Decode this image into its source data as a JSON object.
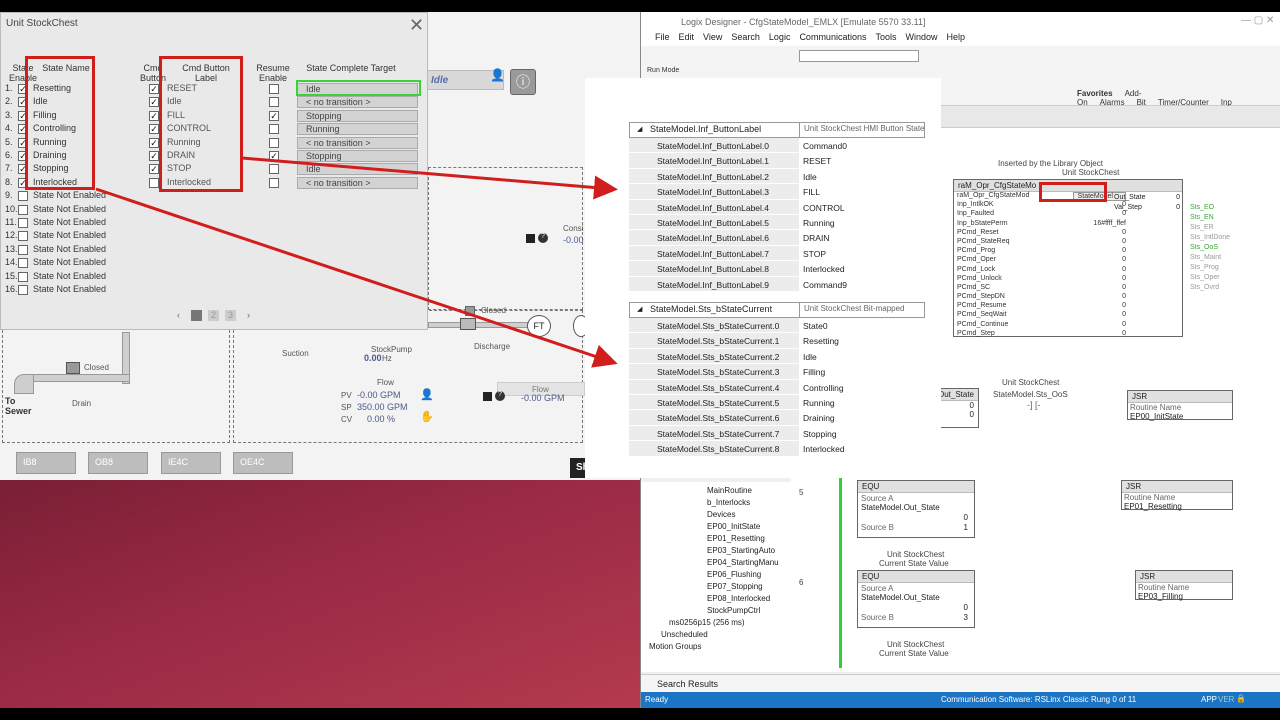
{
  "faceplate": {
    "title": "Unit StockChest",
    "headers": {
      "state_enable": "State Enable",
      "state_name": "State Name",
      "cmd_button": "Cmd Button",
      "cmd_button_label": "Cmd Button Label",
      "resume_enable": "Resume Enable",
      "state_complete_target": "State Complete Target"
    },
    "rows": [
      {
        "n": "1.",
        "enabled": true,
        "name": "Resetting",
        "cmd": true,
        "label": "RESET",
        "resume": false,
        "target": "Idle"
      },
      {
        "n": "2.",
        "enabled": true,
        "name": "Idle",
        "cmd": true,
        "label": "Idle",
        "resume": false,
        "target": "< no transition >"
      },
      {
        "n": "3.",
        "enabled": true,
        "name": "Filling",
        "cmd": true,
        "label": "FILL",
        "resume": true,
        "target": "Stopping"
      },
      {
        "n": "4.",
        "enabled": true,
        "name": "Controlling",
        "cmd": true,
        "label": "CONTROL",
        "resume": false,
        "target": "Running"
      },
      {
        "n": "5.",
        "enabled": true,
        "name": "Running",
        "cmd": true,
        "label": "Running",
        "resume": false,
        "target": "< no transition >"
      },
      {
        "n": "6.",
        "enabled": true,
        "name": "Draining",
        "cmd": true,
        "label": "DRAIN",
        "resume": true,
        "target": "Stopping"
      },
      {
        "n": "7.",
        "enabled": true,
        "name": "Stopping",
        "cmd": true,
        "label": "STOP",
        "resume": false,
        "target": "Idle"
      },
      {
        "n": "8.",
        "enabled": true,
        "name": "Interlocked",
        "cmd": false,
        "label": "Interlocked",
        "resume": false,
        "target": "< no transition >"
      },
      {
        "n": "9.",
        "enabled": false,
        "name": "State Not Enabled"
      },
      {
        "n": "10.",
        "enabled": false,
        "name": "State Not Enabled"
      },
      {
        "n": "11.",
        "enabled": false,
        "name": "State Not Enabled"
      },
      {
        "n": "12.",
        "enabled": false,
        "name": "State Not Enabled"
      },
      {
        "n": "13.",
        "enabled": false,
        "name": "State Not Enabled"
      },
      {
        "n": "14.",
        "enabled": false,
        "name": "State Not Enabled"
      },
      {
        "n": "15.",
        "enabled": false,
        "name": "State Not Enabled"
      },
      {
        "n": "16.",
        "enabled": false,
        "name": "State Not Enabled"
      }
    ],
    "pager": {
      "prev": "‹",
      "page1": "1",
      "page2": "2",
      "page3": "3",
      "next": "›"
    }
  },
  "hmi": {
    "status_value": "Idle",
    "cons_label": "Consi",
    "cons_value": "-0.00",
    "closed1": "Closed",
    "closed2": "Closed",
    "stockpump": "StockPump",
    "pump_hz": "0.00",
    "hz": "Hz",
    "suction": "Suction",
    "discharge": "Discharge",
    "drain": "Drain",
    "to_sewer": "To Sewer",
    "flow1": "Flow",
    "pv_label": "PV",
    "pv_value": "-0.00 GPM",
    "sp_label": "SP",
    "sp_value": "350.00 GPM",
    "cv_label": "CV",
    "cv_value": "0.00 %",
    "flow2": "Flow",
    "flow2_value": "-0.00 GPM",
    "ft": "FT",
    "tags": [
      "IB8",
      "OB8",
      "IE4C",
      "OE4C"
    ],
    "sh": "Sh"
  },
  "overlay": {
    "table1": {
      "header": "StateModel.Inf_ButtonLabel",
      "desc": "Unit StockChest HMI Button State",
      "rows": [
        {
          "tag": "StateModel.Inf_ButtonLabel.0",
          "val": "Command0"
        },
        {
          "tag": "StateModel.Inf_ButtonLabel.1",
          "val": "RESET"
        },
        {
          "tag": "StateModel.Inf_ButtonLabel.2",
          "val": "Idle"
        },
        {
          "tag": "StateModel.Inf_ButtonLabel.3",
          "val": "FILL"
        },
        {
          "tag": "StateModel.Inf_ButtonLabel.4",
          "val": "CONTROL"
        },
        {
          "tag": "StateModel.Inf_ButtonLabel.5",
          "val": "Running"
        },
        {
          "tag": "StateModel.Inf_ButtonLabel.6",
          "val": "DRAIN"
        },
        {
          "tag": "StateModel.Inf_ButtonLabel.7",
          "val": "STOP"
        },
        {
          "tag": "StateModel.Inf_ButtonLabel.8",
          "val": "Interlocked"
        },
        {
          "tag": "StateModel.Inf_ButtonLabel.9",
          "val": "Command9"
        }
      ]
    },
    "table2": {
      "header": "StateModel.Sts_bStateCurrent",
      "desc": "Unit StockChest Bit-mapped",
      "rows": [
        {
          "tag": "StateModel.Sts_bStateCurrent.0",
          "val": "State0"
        },
        {
          "tag": "StateModel.Sts_bStateCurrent.1",
          "val": "Resetting"
        },
        {
          "tag": "StateModel.Sts_bStateCurrent.2",
          "val": "Idle"
        },
        {
          "tag": "StateModel.Sts_bStateCurrent.3",
          "val": "Filling"
        },
        {
          "tag": "StateModel.Sts_bStateCurrent.4",
          "val": "Controlling"
        },
        {
          "tag": "StateModel.Sts_bStateCurrent.5",
          "val": "Running"
        },
        {
          "tag": "StateModel.Sts_bStateCurrent.6",
          "val": "Draining"
        },
        {
          "tag": "StateModel.Sts_bStateCurrent.7",
          "val": "Stopping"
        },
        {
          "tag": "StateModel.Sts_bStateCurrent.8",
          "val": "Interlocked"
        }
      ]
    }
  },
  "logix": {
    "title": "Logix Designer - CfgStateModel_EMLX [Emulate 5570 33.11]",
    "menu": [
      "File",
      "Edit",
      "View",
      "Search",
      "Logic",
      "Communications",
      "Tools",
      "Window",
      "Help"
    ],
    "run_mode": "Run Mode",
    "fav_tabs": [
      "Favorites",
      "Add-On",
      "Alarms",
      "Bit",
      "Timer/Counter",
      "Inp"
    ],
    "inserted_by": "Inserted by the Library Object",
    "unit_label": "Unit StockChest",
    "aoi_name": "raM_Opr_CfgStateMo",
    "aoi_rows": [
      {
        "name": "raM_Opr_CfgStateMod",
        "val": "StateModel"
      },
      {
        "name": "Inp_IntlkOK",
        "val": "0"
      },
      {
        "name": "Inp_Faulted",
        "val": "0"
      },
      {
        "name": "Inp_bStatePerm",
        "val": "16#ffff_ffef"
      },
      {
        "name": "PCmd_Reset",
        "val": "0"
      },
      {
        "name": "PCmd_StateReq",
        "val": "0"
      },
      {
        "name": "PCmd_Prog",
        "val": "0"
      },
      {
        "name": "PCmd_Oper",
        "val": "0"
      },
      {
        "name": "PCmd_Lock",
        "val": "0"
      },
      {
        "name": "PCmd_Unlock",
        "val": "0"
      },
      {
        "name": "PCmd_SC",
        "val": "0"
      },
      {
        "name": "PCmd_StepDN",
        "val": "0"
      },
      {
        "name": "PCmd_Resume",
        "val": "0"
      },
      {
        "name": "PCmd_SeqWait",
        "val": "0"
      },
      {
        "name": "PCmd_Continue",
        "val": "0"
      },
      {
        "name": "PCmd_Step",
        "val": "0"
      }
    ],
    "aoi_outputs": [
      {
        "name": "Out_State",
        "val": "0"
      },
      {
        "name": "Val_Step",
        "val": "0"
      }
    ],
    "aoi_status": [
      "Sts_EO",
      "Sts_EN",
      "Sts_ER",
      "Sts_IntlDone",
      "Sts_OoS",
      "Sts_Maint",
      "Sts_Prog",
      "Sts_Oper",
      "Sts_Ovrd"
    ],
    "rung4": {
      "unit": "Unit StockChest",
      "tag": "StateModel.Sts_OoS",
      "src": "Out_State",
      "v1": "0",
      "v2": "0",
      "jsr": "JSR",
      "routine_label": "Routine Name",
      "routine": "EP00_InitState"
    },
    "rung5": {
      "num": "5",
      "instr": "EQU",
      "srcA_label": "Source A",
      "srcA": "StateModel.Out_State",
      "srcA_val": "0",
      "srcB_label": "Source B",
      "srcB": "1",
      "jsr": "JSR",
      "routine_label": "Routine Name",
      "routine": "EP01_Resetting"
    },
    "rung6": {
      "num": "6",
      "note1": "Unit StockChest",
      "note2": "Current State Value",
      "instr": "EQU",
      "srcA_label": "Source A",
      "srcA": "StateModel.Out_State",
      "srcA_val": "0",
      "srcB_label": "Source B",
      "srcB": "3",
      "jsr": "JSR",
      "routine_label": "Routine Name",
      "routine": "EP03_Filling"
    },
    "rung7": {
      "note1": "Unit StockChest",
      "note2": "Current State Value"
    },
    "tree": [
      "MainRoutine",
      "b_Interlocks",
      "Devices",
      "EP00_InitState",
      "EP01_Resetting",
      "EP03_StartingAuto",
      "EP04_StartingManu",
      "EP06_Flushing",
      "EP07_Stopping",
      "EP08_Interlocked",
      "StockPumpCtrl",
      "ms0256p15 (256 ms)",
      "Unscheduled",
      "Motion Groups"
    ],
    "search_results": "Search Results",
    "status_ready": "Ready",
    "status_comm": "Communication Software: RSLinx Classic",
    "status_rung": "Rung 0 of 11",
    "status_app": "APP",
    "status_ver": "VER"
  },
  "colors": {
    "red_highlight": "#d21d1d",
    "green_highlight": "#3ad13a",
    "status_blue": "#1c74c4"
  }
}
